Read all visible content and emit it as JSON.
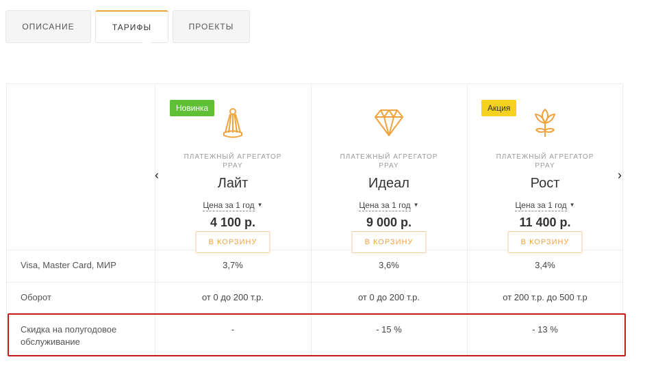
{
  "tabs": [
    {
      "label": "ОПИСАНИЕ"
    },
    {
      "label": "ТАРИФЫ"
    },
    {
      "label": "ПРОЕКТЫ"
    }
  ],
  "plans": [
    {
      "badge": "Новинка",
      "badge_color": "#5fc036",
      "icon": "badminton-shuttlecock-icon",
      "provider": "ПЛАТЕЖНЫЙ АГРЕГАТОР PPAY",
      "name": "Лайт",
      "price_period": "Цена за 1 год",
      "price": "4 100 р.",
      "cart_label": "В КОРЗИНУ"
    },
    {
      "badge": "",
      "badge_color": "",
      "icon": "diamond-icon",
      "provider": "ПЛАТЕЖНЫЙ АГРЕГАТОР PPAY",
      "name": "Идеал",
      "price_period": "Цена за 1 год",
      "price": "9 000 р.",
      "cart_label": "В КОРЗИНУ"
    },
    {
      "badge": "Акция",
      "badge_color": "#f4d21f",
      "icon": "lotus-icon",
      "provider": "ПЛАТЕЖНЫЙ АГРЕГАТОР PPAY",
      "name": "Рост",
      "price_period": "Цена за 1 год",
      "price": "11 400 р.",
      "cart_label": "В КОРЗИНУ"
    }
  ],
  "rows": [
    {
      "label": "Visa, Master Card, МИР",
      "values": [
        "3,7%",
        "3,6%",
        "3,4%"
      ]
    },
    {
      "label": "Оборот",
      "values": [
        "от 0 до 200 т.р.",
        "от 0 до 200 т.р.",
        "от 200 т.р. до 500 т.р"
      ]
    },
    {
      "label": "Скидка на полугодовое обслуживание",
      "values": [
        "-",
        "- 15 %",
        "- 13 %"
      ]
    }
  ],
  "nav": {
    "prev": "‹",
    "next": "›"
  },
  "colors": {
    "accent": "#f0a33c",
    "highlight": "#c01a1a"
  }
}
